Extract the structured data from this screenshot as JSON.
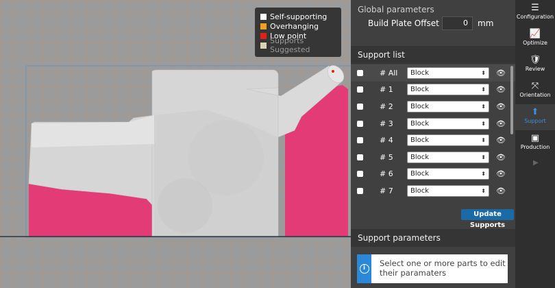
{
  "legend": {
    "items": [
      {
        "label": "Self-supporting",
        "color": "#ffffff"
      },
      {
        "label": "Overhanging",
        "color": "#f0a020"
      },
      {
        "label": "Low point",
        "color": "#e0201a"
      },
      {
        "label": "Supports Suggested",
        "color": "#d8d4b8"
      }
    ]
  },
  "global": {
    "title": "Global parameters",
    "offset_label": "Build Plate Offset",
    "offset_value": "0",
    "offset_unit": "mm"
  },
  "support_list": {
    "title": "Support list",
    "rows": [
      {
        "label": "# All",
        "type": "Block"
      },
      {
        "label": "# 1",
        "type": "Block"
      },
      {
        "label": "# 2",
        "type": "Block"
      },
      {
        "label": "# 3",
        "type": "Block"
      },
      {
        "label": "# 4",
        "type": "Block"
      },
      {
        "label": "# 5",
        "type": "Block"
      },
      {
        "label": "# 6",
        "type": "Block"
      },
      {
        "label": "# 7",
        "type": "Block"
      }
    ],
    "update_label": "Update Supports"
  },
  "support_params": {
    "title": "Support parameters",
    "info_text": "Select one or more parts to edit their paramaters"
  },
  "nav": {
    "items": [
      {
        "label": "Configuration",
        "icon": "sliders-icon"
      },
      {
        "label": "Optimize",
        "icon": "chart-icon"
      },
      {
        "label": "Review",
        "icon": "review-icon"
      },
      {
        "label": "Orientation",
        "icon": "orientation-icon"
      },
      {
        "label": "Support",
        "icon": "support-icon"
      },
      {
        "label": "Production",
        "icon": "printer-icon"
      }
    ],
    "active": "Support"
  },
  "colors": {
    "support_pink": "#e23b76",
    "accent_blue": "#3d8fe0",
    "button_blue": "#1b6aa8"
  }
}
